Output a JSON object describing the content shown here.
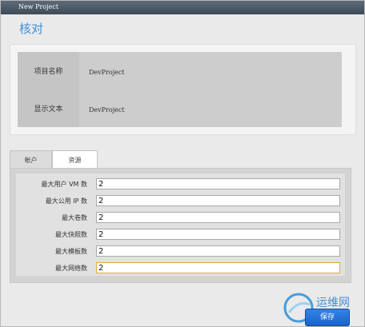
{
  "window": {
    "title": "New Project"
  },
  "page": {
    "title": "核对"
  },
  "info": {
    "project_name_label": "项目名称",
    "project_name_value": "DevProject",
    "display_text_label": "显示文本",
    "display_text_value": "DevProject"
  },
  "tabs": [
    {
      "label": "帐户",
      "selected": false
    },
    {
      "label": "资源",
      "selected": true
    }
  ],
  "fields": [
    {
      "label": "最大用户 VM 数",
      "value": "2"
    },
    {
      "label": "最大公用 IP 数",
      "value": "2"
    },
    {
      "label": "最大卷数",
      "value": "2"
    },
    {
      "label": "最大快照数",
      "value": "2"
    },
    {
      "label": "最大模板数",
      "value": "2"
    },
    {
      "label": "最大网络数",
      "value": "2"
    }
  ],
  "actions": {
    "save_label": "保存"
  },
  "watermark": {
    "text": "运维网"
  },
  "colors": {
    "title_accent": "#3d8fd6",
    "button_blue": "#1a62c8",
    "focus_border": "#e2a93a",
    "titlebar": "#3e4b58"
  }
}
